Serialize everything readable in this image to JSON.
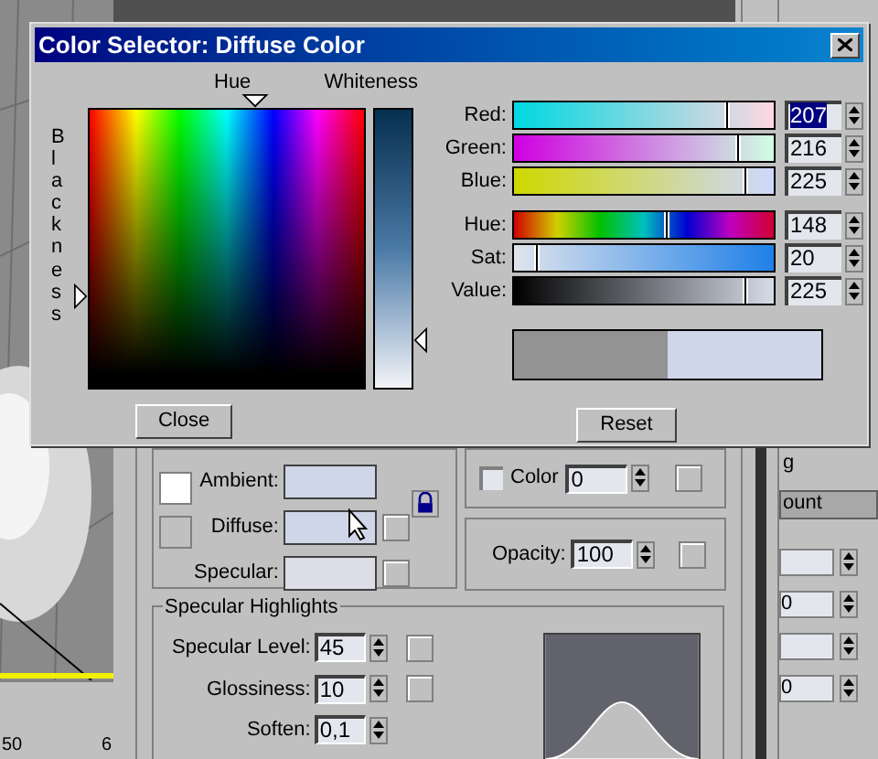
{
  "dialog": {
    "title": "Color Selector: Diffuse Color"
  },
  "picker": {
    "hue_label": "Hue",
    "whiteness_label": "Whiteness",
    "blackness_label": "Blackness"
  },
  "sliders": [
    {
      "kind": "red",
      "label": "Red:",
      "value": "207",
      "level": 0.81,
      "selected": true
    },
    {
      "kind": "green",
      "label": "Green:",
      "value": "216",
      "level": 0.85,
      "selected": false
    },
    {
      "kind": "blue",
      "label": "Blue:",
      "value": "225",
      "level": 0.88,
      "selected": false
    },
    {
      "kind": "hue",
      "label": "Hue:",
      "value": "148",
      "level": 0.58,
      "selected": false
    },
    {
      "kind": "sat",
      "label": "Sat:",
      "value": "20",
      "level": 0.08,
      "selected": false
    },
    {
      "kind": "value",
      "label": "Value:",
      "value": "225",
      "level": 0.88,
      "selected": false
    }
  ],
  "preview": [
    {
      "color": "#939393"
    },
    {
      "color": "#cfd6e8"
    }
  ],
  "buttons": [
    {
      "label": "Close"
    },
    {
      "label": "Reset"
    }
  ],
  "basic_parameters": {
    "swatches": [
      {
        "label": "Ambient:",
        "color": "#cfd6e8",
        "has_map": false
      },
      {
        "label": "Diffuse:",
        "color": "#cfd6e8",
        "has_map": true
      },
      {
        "label": "Specular:",
        "color": "#dcdde6",
        "has_map": true
      }
    ]
  },
  "self_illumination": {
    "label": "Color",
    "checked": false,
    "value": "0"
  },
  "opacity": {
    "label": "Opacity:",
    "value": "100"
  },
  "specular_highlights": {
    "title": "Specular Highlights",
    "fields": [
      {
        "label": "Specular Level:",
        "value": "45",
        "has_map": true
      },
      {
        "label": "Glossiness:",
        "value": "10",
        "has_map": true
      },
      {
        "label": "Soften:",
        "value": "0,1",
        "has_map": false
      }
    ]
  },
  "side_panel": {
    "heading": "g",
    "button": "ount",
    "fields": [
      {
        "value": "0"
      },
      {
        "value": "0"
      }
    ]
  },
  "ruler_labels": [
    "50",
    "6"
  ]
}
